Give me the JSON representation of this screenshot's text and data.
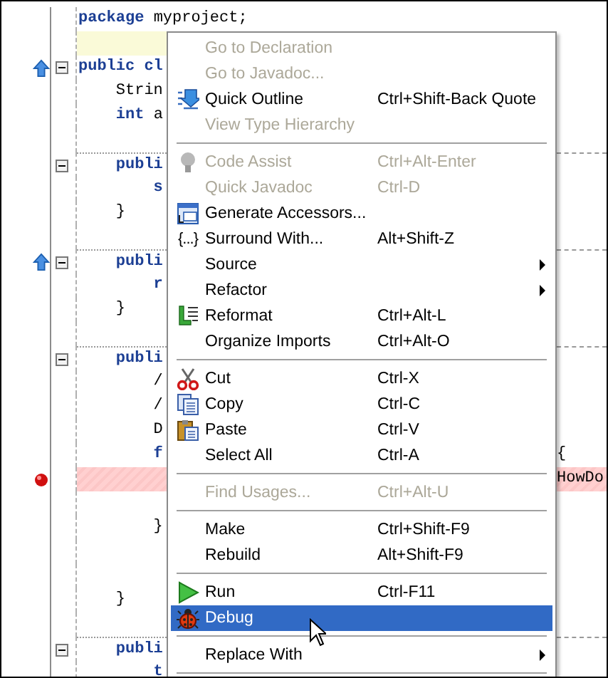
{
  "editor": {
    "lines": [
      {
        "tokens": [
          {
            "text": "package",
            "kind": "keyword"
          },
          {
            "text": " myproject;",
            "kind": "plain"
          }
        ],
        "fold": false,
        "separator": false,
        "override": false,
        "breakpoint": false,
        "current_line": false
      },
      {
        "fold": false,
        "separator": false,
        "override": false,
        "breakpoint": false,
        "current_line": true
      },
      {
        "tokens": [
          {
            "text": "public cl",
            "kind": "keyword"
          }
        ],
        "fold": true,
        "separator": false,
        "override": true,
        "breakpoint": false,
        "current_line": false
      },
      {
        "tokens": [
          {
            "text": "    Strin",
            "kind": "plain"
          }
        ],
        "fold": false,
        "separator": false,
        "override": false,
        "breakpoint": false,
        "current_line": false
      },
      {
        "tokens": [
          {
            "text": "    int",
            "kind": "keyword"
          },
          {
            "text": " a",
            "kind": "plain"
          }
        ],
        "fold": false,
        "separator": false,
        "override": false,
        "breakpoint": false,
        "current_line": false
      },
      {
        "fold": false,
        "separator": false,
        "override": false,
        "breakpoint": false,
        "current_line": false
      },
      {
        "tokens": [
          {
            "text": "    publi",
            "kind": "keyword"
          }
        ],
        "fold": true,
        "separator": true,
        "override": false,
        "breakpoint": false,
        "current_line": false
      },
      {
        "tokens": [
          {
            "text": "        s",
            "kind": "keyword"
          }
        ],
        "fold": false,
        "separator": false,
        "override": false,
        "breakpoint": false,
        "current_line": false
      },
      {
        "tokens": [
          {
            "text": "    }",
            "kind": "plain"
          }
        ],
        "fold": false,
        "separator": false,
        "override": false,
        "breakpoint": false,
        "current_line": false
      },
      {
        "fold": false,
        "separator": false,
        "override": false,
        "breakpoint": false,
        "current_line": false
      },
      {
        "tokens": [
          {
            "text": "    publi",
            "kind": "keyword"
          }
        ],
        "fold": true,
        "separator": true,
        "override": true,
        "breakpoint": false,
        "current_line": false
      },
      {
        "tokens": [
          {
            "text": "        r",
            "kind": "keyword"
          }
        ],
        "fold": false,
        "separator": false,
        "override": false,
        "breakpoint": false,
        "current_line": false
      },
      {
        "tokens": [
          {
            "text": "    }",
            "kind": "plain"
          }
        ],
        "fold": false,
        "separator": false,
        "override": false,
        "breakpoint": false,
        "current_line": false
      },
      {
        "fold": false,
        "separator": false,
        "override": false,
        "breakpoint": false,
        "current_line": false
      },
      {
        "tokens": [
          {
            "text": "    publi",
            "kind": "keyword"
          }
        ],
        "fold": true,
        "separator": true,
        "override": false,
        "breakpoint": false,
        "current_line": false
      },
      {
        "tokens": [
          {
            "text": "        /",
            "kind": "plain"
          }
        ],
        "fold": false,
        "separator": false,
        "override": false,
        "breakpoint": false,
        "current_line": false
      },
      {
        "tokens": [
          {
            "text": "        /",
            "kind": "plain"
          }
        ],
        "fold": false,
        "separator": false,
        "override": false,
        "breakpoint": false,
        "current_line": false
      },
      {
        "tokens": [
          {
            "text": "        D",
            "kind": "plain"
          }
        ],
        "fold": false,
        "separator": false,
        "override": false,
        "breakpoint": false,
        "current_line": false
      },
      {
        "tokens": [
          {
            "text": "        f",
            "kind": "keyword"
          }
        ],
        "right": "{",
        "fold": false,
        "separator": false,
        "override": false,
        "breakpoint": false,
        "current_line": false
      },
      {
        "right": "HowDo",
        "fold": false,
        "separator": false,
        "override": false,
        "breakpoint": true,
        "current_line": false
      },
      {
        "fold": false,
        "separator": false,
        "override": false,
        "breakpoint": false,
        "current_line": false
      },
      {
        "tokens": [
          {
            "text": "        }",
            "kind": "plain"
          }
        ],
        "fold": false,
        "separator": false,
        "override": false,
        "breakpoint": false,
        "current_line": false
      },
      {
        "fold": false,
        "separator": false,
        "override": false,
        "breakpoint": false,
        "current_line": false
      },
      {
        "fold": false,
        "separator": false,
        "override": false,
        "breakpoint": false,
        "current_line": false
      },
      {
        "tokens": [
          {
            "text": "    }",
            "kind": "plain"
          }
        ],
        "fold": false,
        "separator": false,
        "override": false,
        "breakpoint": false,
        "current_line": false
      },
      {
        "fold": false,
        "separator": false,
        "override": false,
        "breakpoint": false,
        "current_line": false
      },
      {
        "tokens": [
          {
            "text": "    publi",
            "kind": "keyword"
          }
        ],
        "fold": true,
        "separator": true,
        "override": false,
        "breakpoint": false,
        "current_line": false
      },
      {
        "tokens": [
          {
            "text": "        t",
            "kind": "keyword"
          }
        ],
        "fold": false,
        "separator": false,
        "override": false,
        "breakpoint": false,
        "current_line": false
      }
    ]
  },
  "context_menu": {
    "items": [
      {
        "kind": "item",
        "label": "Go to Declaration",
        "disabled": true,
        "selected": false,
        "submenu": false
      },
      {
        "kind": "item",
        "label": "Go to Javadoc...",
        "disabled": true,
        "selected": false,
        "submenu": false
      },
      {
        "kind": "item",
        "label": "Quick Outline",
        "shortcut": "Ctrl+Shift-Back Quote",
        "disabled": false,
        "selected": false,
        "submenu": false
      },
      {
        "kind": "item",
        "label": "View Type Hierarchy",
        "disabled": true,
        "selected": false,
        "submenu": false
      },
      {
        "kind": "separator"
      },
      {
        "kind": "item",
        "label": "Code Assist",
        "shortcut": "Ctrl+Alt-Enter",
        "disabled": true,
        "selected": false,
        "submenu": false
      },
      {
        "kind": "item",
        "label": "Quick Javadoc",
        "shortcut": "Ctrl-D",
        "disabled": true,
        "selected": false,
        "submenu": false
      },
      {
        "kind": "item",
        "label": "Generate Accessors...",
        "disabled": false,
        "selected": false,
        "submenu": false
      },
      {
        "kind": "item",
        "label": "Surround With...",
        "shortcut": "Alt+Shift-Z",
        "icon_text": "{...}",
        "disabled": false,
        "selected": false,
        "submenu": false
      },
      {
        "kind": "item",
        "label": "Source",
        "disabled": false,
        "selected": false,
        "submenu": true
      },
      {
        "kind": "item",
        "label": "Refactor",
        "disabled": false,
        "selected": false,
        "submenu": true
      },
      {
        "kind": "item",
        "label": "Reformat",
        "shortcut": "Ctrl+Alt-L",
        "disabled": false,
        "selected": false,
        "submenu": false
      },
      {
        "kind": "item",
        "label": "Organize Imports",
        "shortcut": "Ctrl+Alt-O",
        "disabled": false,
        "selected": false,
        "submenu": false
      },
      {
        "kind": "separator"
      },
      {
        "kind": "item",
        "label": "Cut",
        "shortcut": "Ctrl-X",
        "disabled": false,
        "selected": false,
        "submenu": false
      },
      {
        "kind": "item",
        "label": "Copy",
        "shortcut": "Ctrl-C",
        "disabled": false,
        "selected": false,
        "submenu": false
      },
      {
        "kind": "item",
        "label": "Paste",
        "shortcut": "Ctrl-V",
        "disabled": false,
        "selected": false,
        "submenu": false
      },
      {
        "kind": "item",
        "label": "Select All",
        "shortcut": "Ctrl-A",
        "disabled": false,
        "selected": false,
        "submenu": false
      },
      {
        "kind": "separator"
      },
      {
        "kind": "item",
        "label": "Find Usages...",
        "shortcut": "Ctrl+Alt-U",
        "disabled": true,
        "selected": false,
        "submenu": false
      },
      {
        "kind": "separator"
      },
      {
        "kind": "item",
        "label": "Make",
        "shortcut": "Ctrl+Shift-F9",
        "disabled": false,
        "selected": false,
        "submenu": false
      },
      {
        "kind": "item",
        "label": "Rebuild",
        "shortcut": "Alt+Shift-F9",
        "disabled": false,
        "selected": false,
        "submenu": false
      },
      {
        "kind": "separator"
      },
      {
        "kind": "item",
        "label": "Run",
        "shortcut": "Ctrl-F11",
        "disabled": false,
        "selected": false,
        "submenu": false
      },
      {
        "kind": "item",
        "label": "Debug",
        "disabled": false,
        "selected": true,
        "submenu": false
      },
      {
        "kind": "separator"
      },
      {
        "kind": "item",
        "label": "Replace With",
        "disabled": false,
        "selected": false,
        "submenu": true
      },
      {
        "kind": "separator"
      }
    ]
  }
}
